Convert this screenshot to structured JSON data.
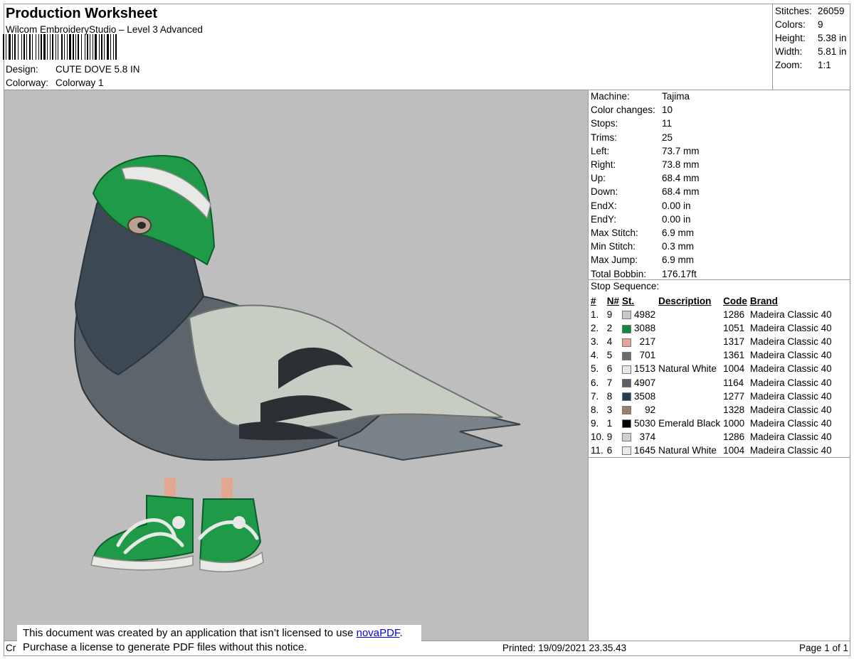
{
  "header": {
    "title": "Production Worksheet",
    "software": "Wilcom EmbroideryStudio – Level 3 Advanced",
    "design_label": "Design:",
    "design_value": "CUTE DOVE 5.8 IN",
    "colorway_label": "Colorway:",
    "colorway_value": "Colorway 1"
  },
  "summary": [
    {
      "label": "Stitches:",
      "value": "26059"
    },
    {
      "label": "Colors:",
      "value": "9"
    },
    {
      "label": "Height:",
      "value": "5.38 in"
    },
    {
      "label": "Width:",
      "value": "5.81 in"
    },
    {
      "label": "Zoom:",
      "value": "1:1"
    }
  ],
  "specs": [
    {
      "label": "Machine:",
      "value": "Tajima"
    },
    {
      "label": "Color changes:",
      "value": "10"
    },
    {
      "label": "Stops:",
      "value": "11"
    },
    {
      "label": "Trims:",
      "value": "25"
    },
    {
      "label": "Left:",
      "value": "73.7 mm"
    },
    {
      "label": "Right:",
      "value": "73.8 mm"
    },
    {
      "label": "Up:",
      "value": "68.4 mm"
    },
    {
      "label": "Down:",
      "value": "68.4 mm"
    },
    {
      "label": "EndX:",
      "value": "0.00 in"
    },
    {
      "label": "EndY:",
      "value": "0.00 in"
    },
    {
      "label": "Max Stitch:",
      "value": "6.9 mm"
    },
    {
      "label": "Min Stitch:",
      "value": "0.3 mm"
    },
    {
      "label": "Max Jump:",
      "value": "6.9 mm"
    },
    {
      "label": "Total Bobbin:",
      "value": "176.17ft"
    }
  ],
  "stop_sequence": {
    "title": "Stop Sequence:",
    "headers": {
      "num": "#",
      "n": "N#",
      "st": "St.",
      "desc": "Description",
      "code": "Code",
      "brand": "Brand"
    },
    "rows": [
      {
        "num": "1.",
        "n": "9",
        "color": "#c8c8c4",
        "st": "4982",
        "desc": "",
        "code": "1286",
        "brand": "Madeira Classic 40"
      },
      {
        "num": "2.",
        "n": "2",
        "color": "#0e8a3e",
        "st": "3088",
        "desc": "",
        "code": "1051",
        "brand": "Madeira Classic 40"
      },
      {
        "num": "3.",
        "n": "4",
        "color": "#e8a392",
        "st": "217",
        "desc": "",
        "code": "1317",
        "brand": "Madeira Classic 40"
      },
      {
        "num": "4.",
        "n": "5",
        "color": "#6b6b6b",
        "st": "701",
        "desc": "",
        "code": "1361",
        "brand": "Madeira Classic 40"
      },
      {
        "num": "5.",
        "n": "6",
        "color": "#e8e8ec",
        "st": "1513",
        "desc": "Natural White",
        "code": "1004",
        "brand": "Madeira Classic 40"
      },
      {
        "num": "6.",
        "n": "7",
        "color": "#5a5f68",
        "st": "4907",
        "desc": "",
        "code": "1164",
        "brand": "Madeira Classic 40"
      },
      {
        "num": "7.",
        "n": "8",
        "color": "#283a52",
        "st": "3508",
        "desc": "",
        "code": "1277",
        "brand": "Madeira Classic 40"
      },
      {
        "num": "8.",
        "n": "3",
        "color": "#9e7c6e",
        "st": "92",
        "desc": "",
        "code": "1328",
        "brand": "Madeira Classic 40"
      },
      {
        "num": "9.",
        "n": "1",
        "color": "#050505",
        "st": "5030",
        "desc": "Emerald Black",
        "code": "1000",
        "brand": "Madeira Classic 40"
      },
      {
        "num": "10.",
        "n": "9",
        "color": "#d0cfca",
        "st": "374",
        "desc": "",
        "code": "1286",
        "brand": "Madeira Classic 40"
      },
      {
        "num": "11.",
        "n": "6",
        "color": "#e8e8ec",
        "st": "1645",
        "desc": "Natural White",
        "code": "1004",
        "brand": "Madeira Classic 40"
      }
    ]
  },
  "footer": {
    "left": "Cr",
    "printed": "Printed: 19/09/2021 23.35.43",
    "page": "Page 1 of 1"
  },
  "notice": {
    "line1_pre": "This document was created by an application that isn’t licensed to use ",
    "link": "novaPDF",
    "line1_post": ".",
    "line2": "Purchase a license to generate PDF files without this notice."
  },
  "colors": {
    "preview_bg": "#c0c0c0",
    "hat_green": "#1e9a48",
    "body_dark": "#3c4a55",
    "wing_light": "#c9cfc4"
  }
}
